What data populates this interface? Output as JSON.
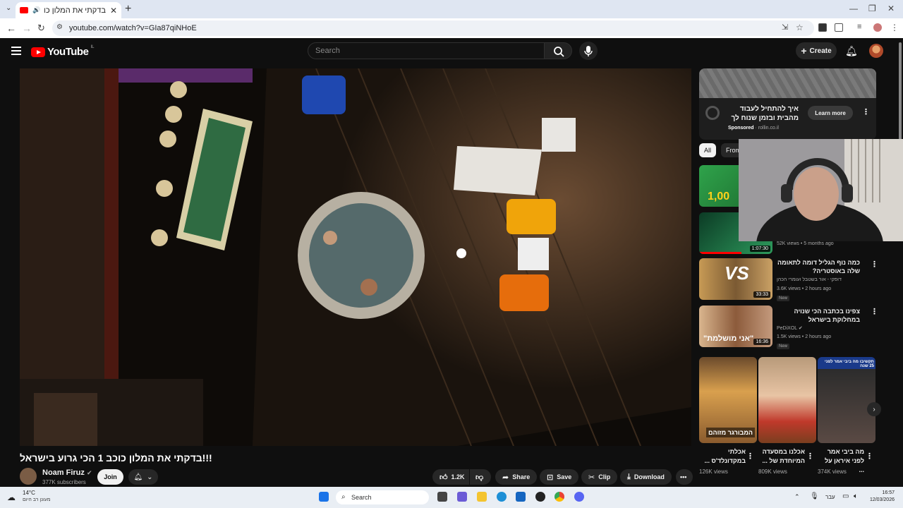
{
  "browser": {
    "tab_title": "בדקתי את המלון כוכב 1 הכי",
    "url": "youtube.com/watch?v=GIa87qiNHoE",
    "new_tab": "+"
  },
  "masthead": {
    "logo_text": "YouTube",
    "logo_country": "IL",
    "search_placeholder": "Search",
    "create_label": "Create"
  },
  "video": {
    "title": "!!!בדקתי את המלון כוכב 1 הכי גרוע בישראל",
    "channel_name": "Noam Firuz",
    "subscribers": "377K subscribers",
    "join_label": "Join",
    "likes": "1.2K",
    "share_label": "Share",
    "save_label": "Save",
    "clip_label": "Clip",
    "download_label": "Download"
  },
  "ad": {
    "text": "איך להתחיל לעבוד מהבית ובזמן שנוח לך",
    "sponsored": "Sponsored",
    "domain": "· rollin.co.il",
    "cta": "Learn more"
  },
  "chips": [
    {
      "label": "All"
    },
    {
      "label": "From"
    }
  ],
  "recommendations": [
    {
      "duration": "",
      "badge_text": "1,00",
      "title": "",
      "meta": "",
      "time": ""
    },
    {
      "duration": "1:07:30",
      "title": "",
      "meta": "52K views",
      "time": "5 months ago"
    },
    {
      "duration": "33:33",
      "title": "כמה נוף הגליל דומה לתאומה שלה באוסטריה?",
      "channel": "דופקי - אור בשטבל ועומרי הכהן",
      "meta": "3.6K views",
      "time": "2 hours ago",
      "new": "New"
    },
    {
      "duration": "16:36",
      "title": "צפינו בכתבה הכי שנויה במחלוקת בישראל",
      "channel": "PeDiXOL",
      "meta": "1.5K views",
      "time": "2 hours ago",
      "new": "New",
      "overlay": "\"אני מושלמת\""
    }
  ],
  "shorts": [
    {
      "title": "אכלתי במקדונלד'ס ...",
      "views": "126K views",
      "overlay": "המבורגר מזוהם"
    },
    {
      "title": "אכלנו במסעדה המיוחדת של ...",
      "views": "809K views",
      "overlay": ""
    },
    {
      "title": "מה ביבי אמר לפני איראן על ...",
      "views": "374K views",
      "overlay": "תקשיבו מה ביבי אמר לפני 25 שנה"
    }
  ],
  "taskbar": {
    "temp": "14°C",
    "weather": "מעונן רב היום",
    "search": "Search",
    "lang": "עבר",
    "time": "16:57",
    "date": "12/03/2026"
  },
  "colors": {
    "yt_red": "#ff0000",
    "bg": "#0f0f0f",
    "pill": "#272727"
  }
}
